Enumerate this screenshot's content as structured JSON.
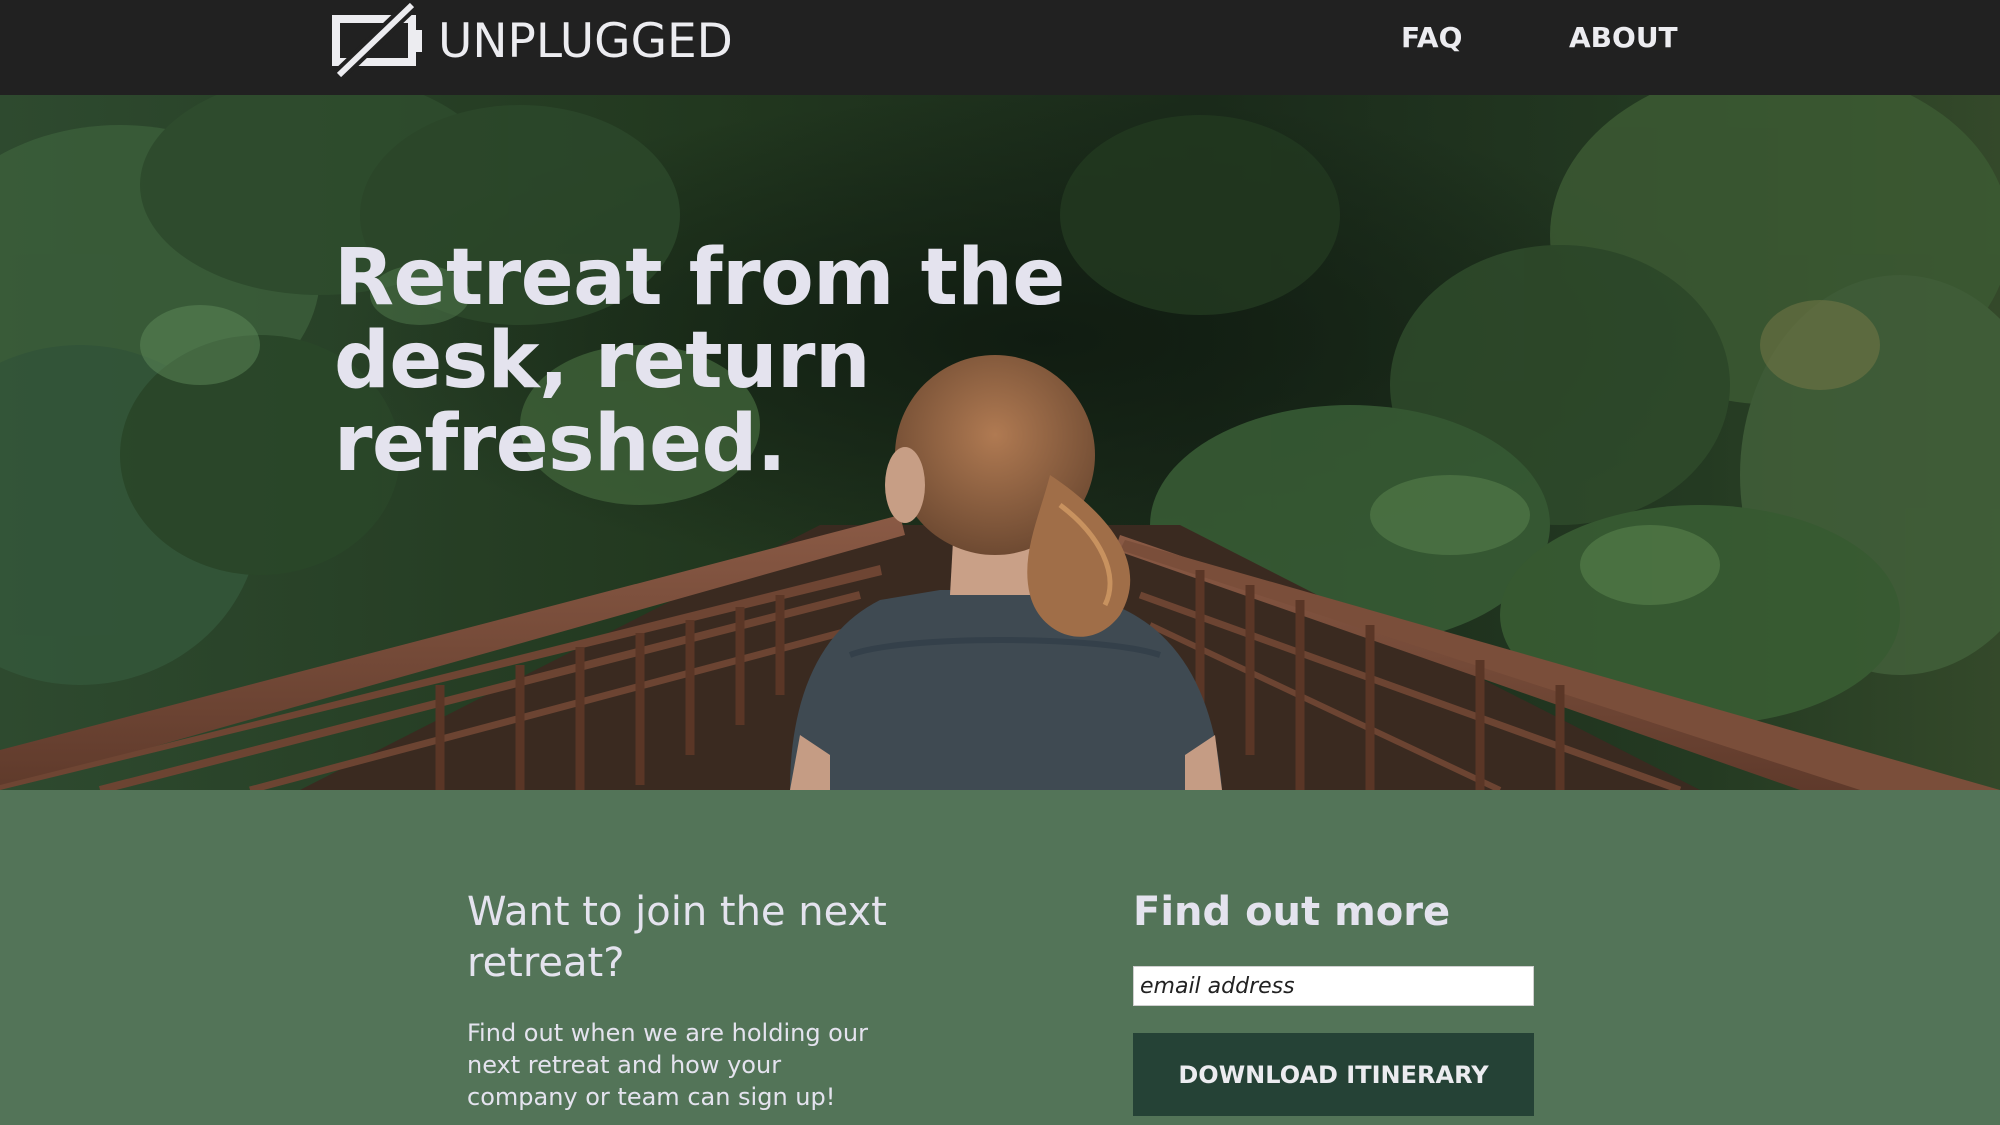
{
  "header": {
    "brand": "UNPLUGGED",
    "logo_icon": "battery-crossed-icon",
    "nav": [
      {
        "label": "FAQ"
      },
      {
        "label": "ABOUT"
      }
    ]
  },
  "hero": {
    "title": "Retreat from the desk, return refreshed."
  },
  "signup": {
    "join_title": "Want to join the next retreat?",
    "join_text": "Find out when we are holding our next retreat and how your company or team can sign up!",
    "more_title": "Find out more",
    "email_placeholder": "email address",
    "button_label": "DOWNLOAD ITINERARY"
  },
  "colors": {
    "header_bg": "#212121",
    "section_bg": "#537458",
    "button_bg": "#254236",
    "text_light": "#e4e3ee"
  }
}
